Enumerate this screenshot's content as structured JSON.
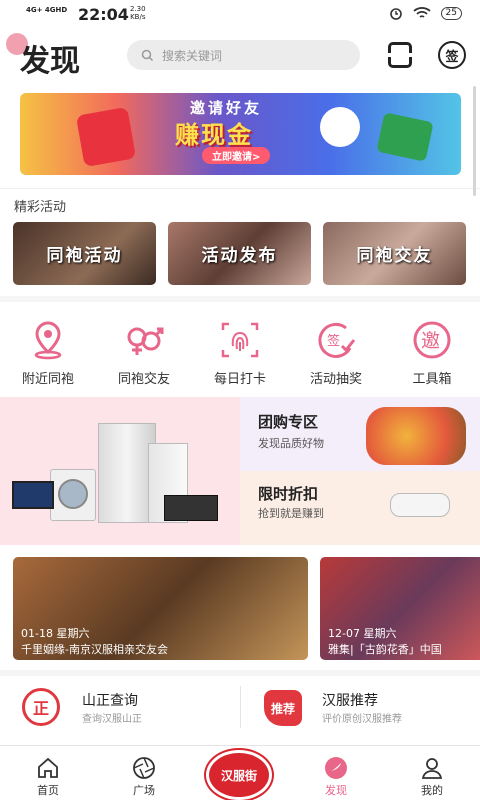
{
  "status": {
    "network": "4G+ 4GHD",
    "time": "22:04",
    "speed": "2.30\nKB/s",
    "battery": "25"
  },
  "header": {
    "title": "发现",
    "search_placeholder": "搜索关键词",
    "sign_label": "签"
  },
  "banner": {
    "line1": "邀请好友",
    "line2": "赚现金",
    "cta": "立即邀请>"
  },
  "section": {
    "activities_label": "精彩活动"
  },
  "activities": [
    {
      "label": "同袍活动",
      "color": "#6b4a3a"
    },
    {
      "label": "活动发布",
      "color": "#8a5a44"
    },
    {
      "label": "同袍交友",
      "color": "#7a5b4c"
    }
  ],
  "shortcuts": [
    {
      "label": "附近同袍",
      "icon": "location-pin-icon"
    },
    {
      "label": "同袍交友",
      "icon": "gender-icon"
    },
    {
      "label": "每日打卡",
      "icon": "fingerprint-icon"
    },
    {
      "label": "活动抽奖",
      "icon": "sign-check-icon"
    },
    {
      "label": "工具箱",
      "icon": "invite-tool-icon"
    }
  ],
  "promo": {
    "group_title": "团购专区",
    "group_sub": "发现品质好物",
    "flash_title": "限时折扣",
    "flash_sub": "抢到就是赚到",
    "group_color": "#c77ad8",
    "flash_color": "#e8612c"
  },
  "events": [
    {
      "date": "01-18 星期六",
      "name": "千里姻缘-南京汉服相亲交友会"
    },
    {
      "date": "12-07 星期六",
      "name": "雅集|「古韵花香」中国"
    }
  ],
  "links": [
    {
      "icon_text": "正",
      "title": "山正查询",
      "sub": "查询汉服山正"
    },
    {
      "icon_text": "推荐",
      "title": "汉服推荐",
      "sub": "评价原创汉服推荐"
    }
  ],
  "tabs": [
    {
      "label": "首页",
      "icon": "home-icon"
    },
    {
      "label": "广场",
      "icon": "aperture-icon"
    },
    {
      "label": "汉服街",
      "icon": "hanfu-street-icon"
    },
    {
      "label": "发现",
      "icon": "discover-icon"
    },
    {
      "label": "我的",
      "icon": "profile-icon"
    }
  ],
  "colors": {
    "accent": "#e0383e",
    "pink": "#e8668a"
  }
}
